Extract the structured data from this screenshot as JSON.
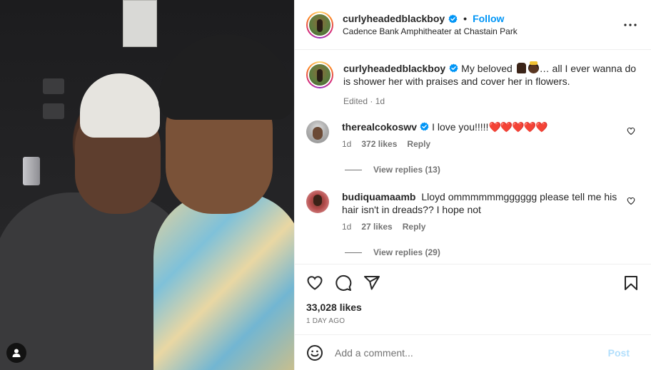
{
  "header": {
    "username": "curlyheadedblackboy",
    "separator": "•",
    "follow_label": "Follow",
    "location": "Cadence Bank Amphitheater at Chastain Park"
  },
  "caption": {
    "username": "curlyheadedblackboy",
    "text_before_emoji": "My beloved",
    "text_after_emoji": "… all I ever wanna do is shower her with praises and cover her in flowers.",
    "meta": "Edited · 1d"
  },
  "comments": [
    {
      "username": "therealcokoswv",
      "text": "I love you!!!!!",
      "hearts": "❤️❤️❤️❤️❤️",
      "age": "1d",
      "likes": "372 likes",
      "reply_label": "Reply",
      "view_replies": "View replies (13)"
    },
    {
      "username": "budiquamaamb",
      "text": "Lloyd ommmmmmgggggg please tell me his hair isn't in dreads?? I hope not",
      "age": "1d",
      "likes": "27 likes",
      "reply_label": "Reply",
      "view_replies": "View replies (29)"
    }
  ],
  "engagement": {
    "likes": "33,028 likes",
    "date": "1 DAY AGO"
  },
  "add_comment": {
    "placeholder": "Add a comment...",
    "post_label": "Post"
  },
  "colors": {
    "accent": "#0095f6",
    "post_disabled": "#b2dffc",
    "heart_red": "#e0245e",
    "muted": "#737373",
    "text": "#262626"
  },
  "icons": {
    "verified": "verified-badge-icon",
    "more": "more-options-icon",
    "like": "heart-icon",
    "comment": "comment-bubble-icon",
    "share": "paper-plane-icon",
    "save": "bookmark-icon",
    "emoji": "smiley-icon",
    "tag": "user-tag-icon"
  }
}
